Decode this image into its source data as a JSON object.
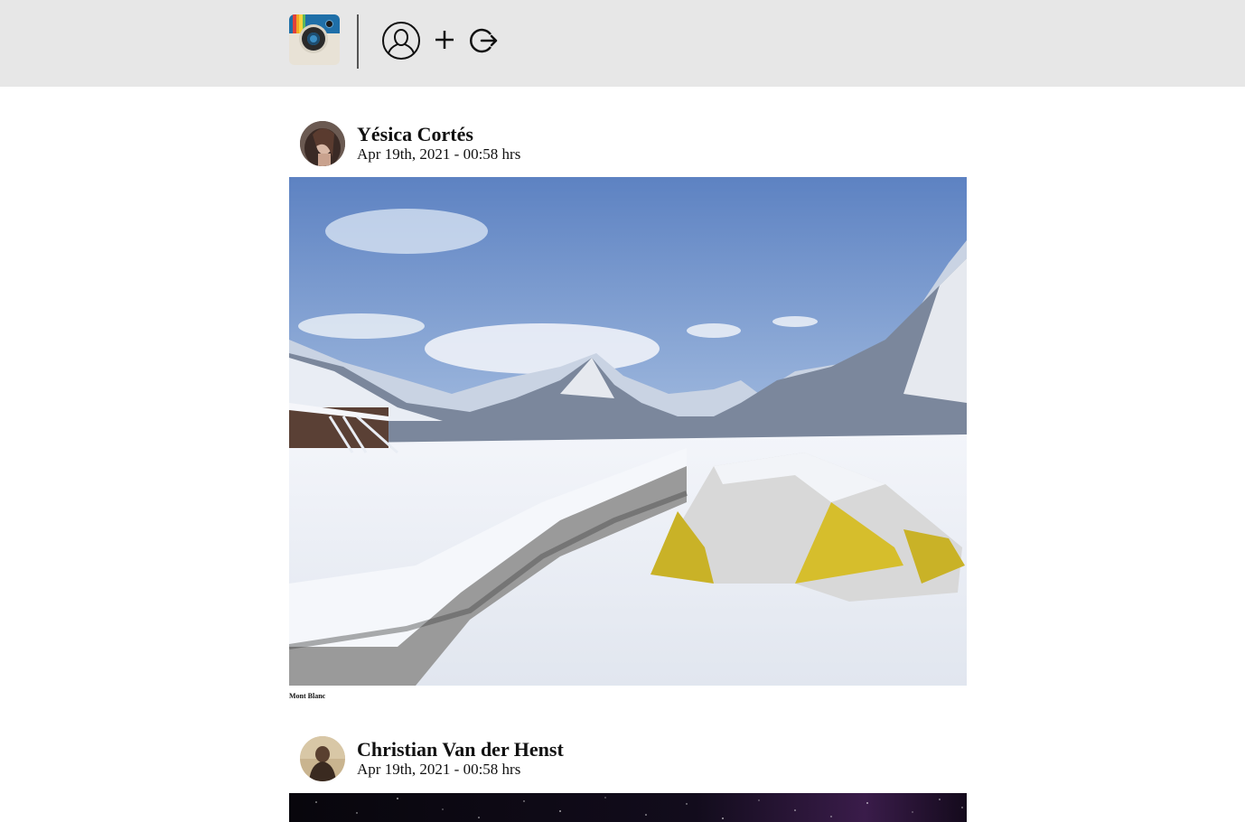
{
  "header": {
    "logo_icon": "instagram-camera-logo",
    "nav": [
      {
        "icon": "user-profile-icon"
      },
      {
        "icon": "plus-icon"
      },
      {
        "icon": "logout-icon"
      }
    ],
    "background": "#e7e7e7"
  },
  "feed": [
    {
      "author": "Yésica Cortés",
      "date": "Apr 19th, 2021 - 00:58 hrs",
      "photo_subject": "snowy-mountain-camp",
      "caption": "Mont Blanc"
    },
    {
      "author": "Christian Van der Henst",
      "date": "Apr 19th, 2021 - 00:58 hrs",
      "photo_subject": "starry-night-sky",
      "caption": ""
    }
  ]
}
